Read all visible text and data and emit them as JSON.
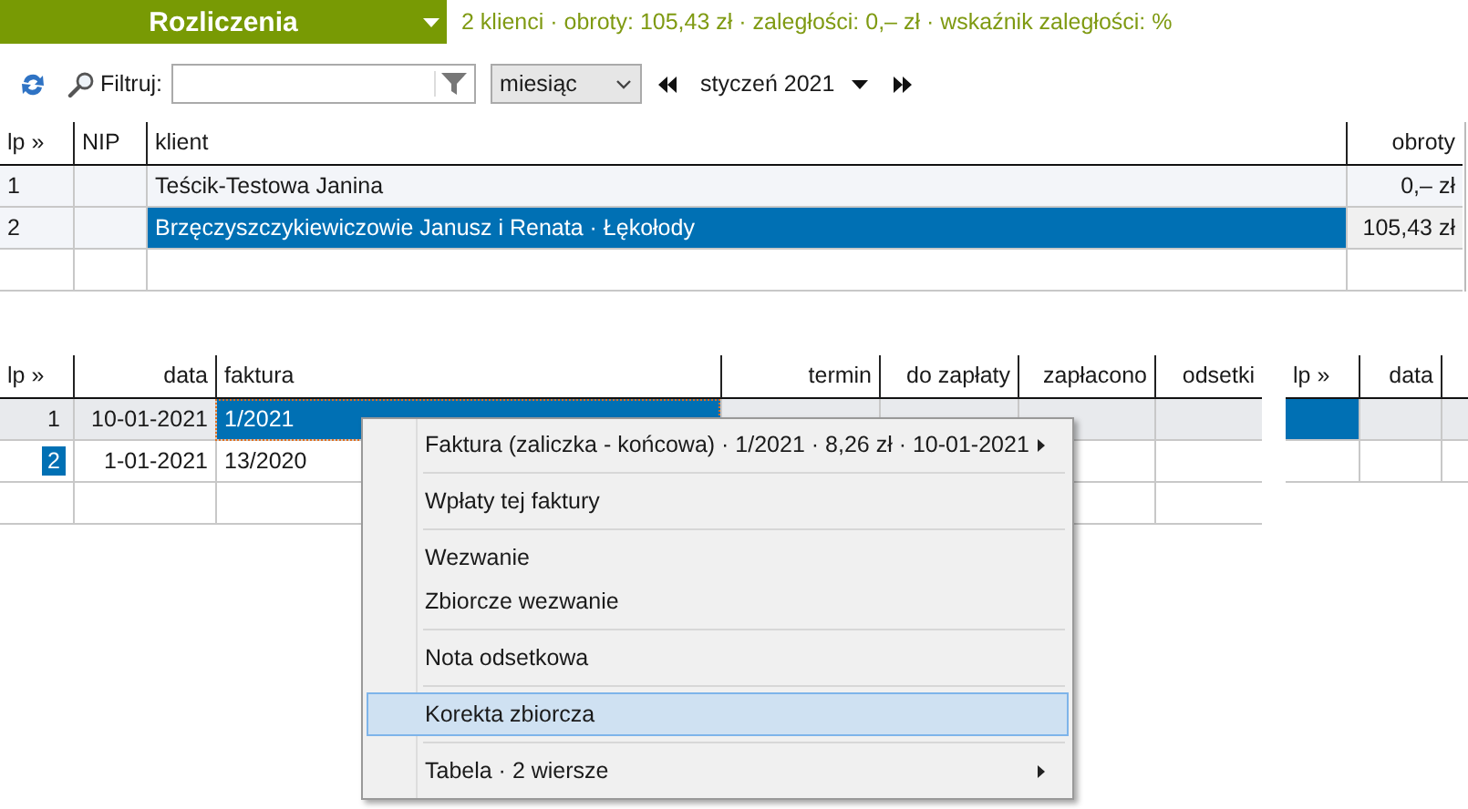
{
  "header": {
    "title": "Rozliczenia",
    "summary": "2 klienci · obroty: 105,43 zł · zaległości: 0,– zł · wskaźnik zaległości: %"
  },
  "toolbar": {
    "filter_label": "Filtruj:",
    "period": "miesiąc",
    "month": "styczeń 2021"
  },
  "clients": {
    "columns": [
      "lp »",
      "NIP",
      "klient",
      "obroty"
    ],
    "rows": [
      {
        "lp": "1",
        "client": "Teścik-Testowa Janina",
        "turnover": "0,– zł",
        "selected": false
      },
      {
        "lp": "2",
        "client": "Brzęczyszczykiewiczowie Janusz i Renata · Łękołody",
        "turnover": "105,43 zł",
        "selected": true
      }
    ]
  },
  "invoices": {
    "columns": [
      "lp »",
      "data",
      "faktura",
      "termin",
      "do zapłaty",
      "zapłacono",
      "odsetki"
    ],
    "rows": [
      {
        "lp": "1",
        "date": "10-01-2021",
        "invoice": "1/2021",
        "selected": true,
        "lp_highlighted": false
      },
      {
        "lp": "2",
        "date": "1-01-2021",
        "invoice": "13/2020",
        "selected": false,
        "lp_highlighted": true
      }
    ]
  },
  "payments": {
    "columns": [
      "lp »",
      "data"
    ],
    "rows": [
      {
        "selected": true
      },
      {
        "selected": false
      }
    ]
  },
  "context_menu": {
    "items": [
      {
        "kind": "item",
        "label": "Faktura (zaliczka - końcowa) · 1/2021 · 8,26 zł · 10-01-2021",
        "submenu": true,
        "selected": false
      },
      {
        "kind": "separator"
      },
      {
        "kind": "item",
        "label": "Wpłaty tej faktury",
        "submenu": false,
        "selected": false
      },
      {
        "kind": "separator"
      },
      {
        "kind": "item",
        "label": "Wezwanie",
        "submenu": false,
        "selected": false
      },
      {
        "kind": "item",
        "label": "Zbiorcze wezwanie",
        "submenu": false,
        "selected": false
      },
      {
        "kind": "separator"
      },
      {
        "kind": "item",
        "label": "Nota odsetkowa",
        "submenu": false,
        "selected": false
      },
      {
        "kind": "separator"
      },
      {
        "kind": "item",
        "label": "Korekta zbiorcza",
        "submenu": false,
        "selected": true
      },
      {
        "kind": "separator"
      },
      {
        "kind": "item",
        "label": "Tabela · 2 wiersze",
        "submenu": true,
        "selected": false
      }
    ]
  }
}
